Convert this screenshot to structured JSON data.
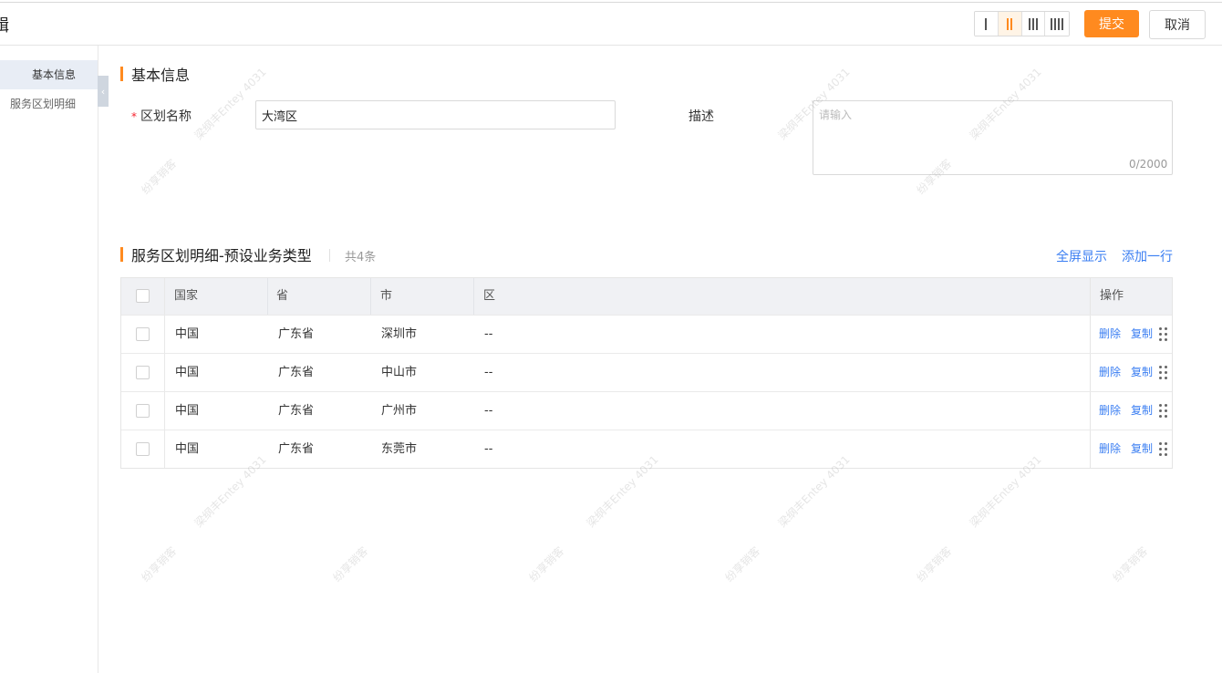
{
  "header": {
    "title": "辑",
    "layout_options": [
      "I",
      "II",
      "III",
      "IIII"
    ],
    "active_layout": 1,
    "submit_label": "提交",
    "cancel_label": "取消"
  },
  "sidebar": {
    "items": [
      {
        "label": "基本信息",
        "active": true
      },
      {
        "label": "服务区划明细",
        "active": false
      }
    ]
  },
  "basic_info": {
    "section_title": "基本信息",
    "name_label": "区划名称",
    "required_mark": "*",
    "name_value": "大湾区",
    "desc_label": "描述",
    "desc_placeholder": "请输入",
    "desc_count": "0/2000"
  },
  "detail": {
    "section_title": "服务区划明细-预设业务类型",
    "count_text": "共4条",
    "fullscreen_label": "全屏显示",
    "add_row_label": "添加一行",
    "columns": [
      "国家",
      "省",
      "市",
      "区",
      "操作"
    ],
    "rows": [
      {
        "country": "中国",
        "province": "广东省",
        "city": "深圳市",
        "district": "--"
      },
      {
        "country": "中国",
        "province": "广东省",
        "city": "中山市",
        "district": "--"
      },
      {
        "country": "中国",
        "province": "广东省",
        "city": "广州市",
        "district": "--"
      },
      {
        "country": "中国",
        "province": "广东省",
        "city": "东莞市",
        "district": "--"
      }
    ],
    "delete_label": "删除",
    "copy_label": "复制"
  },
  "watermark": {
    "line1": "梁纲丰Entey 4031",
    "line2": "纷享销客"
  },
  "colors": {
    "accent": "#ff8a1f",
    "link": "#3a7ef2",
    "required": "#f5222d"
  }
}
